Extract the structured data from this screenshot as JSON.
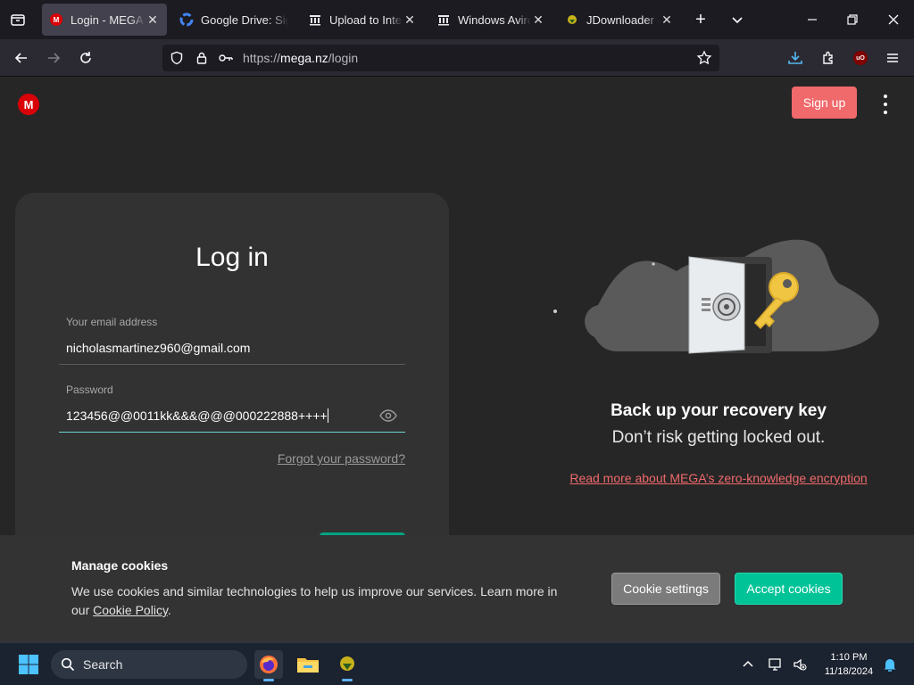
{
  "browser": {
    "tabs": [
      {
        "title": "Login - MEGA",
        "favicon": "mega-icon",
        "active": true
      },
      {
        "title": "Google Drive: Sign-in",
        "favicon": "google-icon",
        "active": false
      },
      {
        "title": "Upload to Internet Archive",
        "favicon": "archive-icon",
        "active": false
      },
      {
        "title": "Windows Aviro",
        "favicon": "archive-icon",
        "active": false
      },
      {
        "title": "JDownloader - Official",
        "favicon": "jdownloader-icon",
        "active": false
      }
    ],
    "url_prefix": "https://",
    "url_host": "mega.nz",
    "url_path": "/login"
  },
  "page": {
    "signup_label": "Sign up",
    "login": {
      "heading": "Log in",
      "email_label": "Your email address",
      "email_value": "nicholasmartinez960@gmail.com",
      "password_label": "Password",
      "password_value": "123456@@0011kk&&&@@@000222888++++",
      "forgot_label": "Forgot your password?"
    },
    "promo": {
      "heading": "Back up your recovery key",
      "subheading": "Don’t risk getting locked out.",
      "link": "Read more about MEGA’s zero-knowledge encryption"
    }
  },
  "cookie_banner": {
    "title": "Manage cookies",
    "body_prefix": "We use cookies and similar technologies to help us improve our services. Learn more in our",
    "policy_link": "Cookie Policy",
    "body_suffix": ".",
    "settings_label": "Cookie settings",
    "accept_label": "Accept cookies"
  },
  "taskbar": {
    "search_label": "Search",
    "time": "1:10 PM",
    "date": "11/18/2024"
  },
  "colors": {
    "accent_red": "#f0696b",
    "accent_green": "#00c398",
    "mega_red": "#d90007"
  }
}
